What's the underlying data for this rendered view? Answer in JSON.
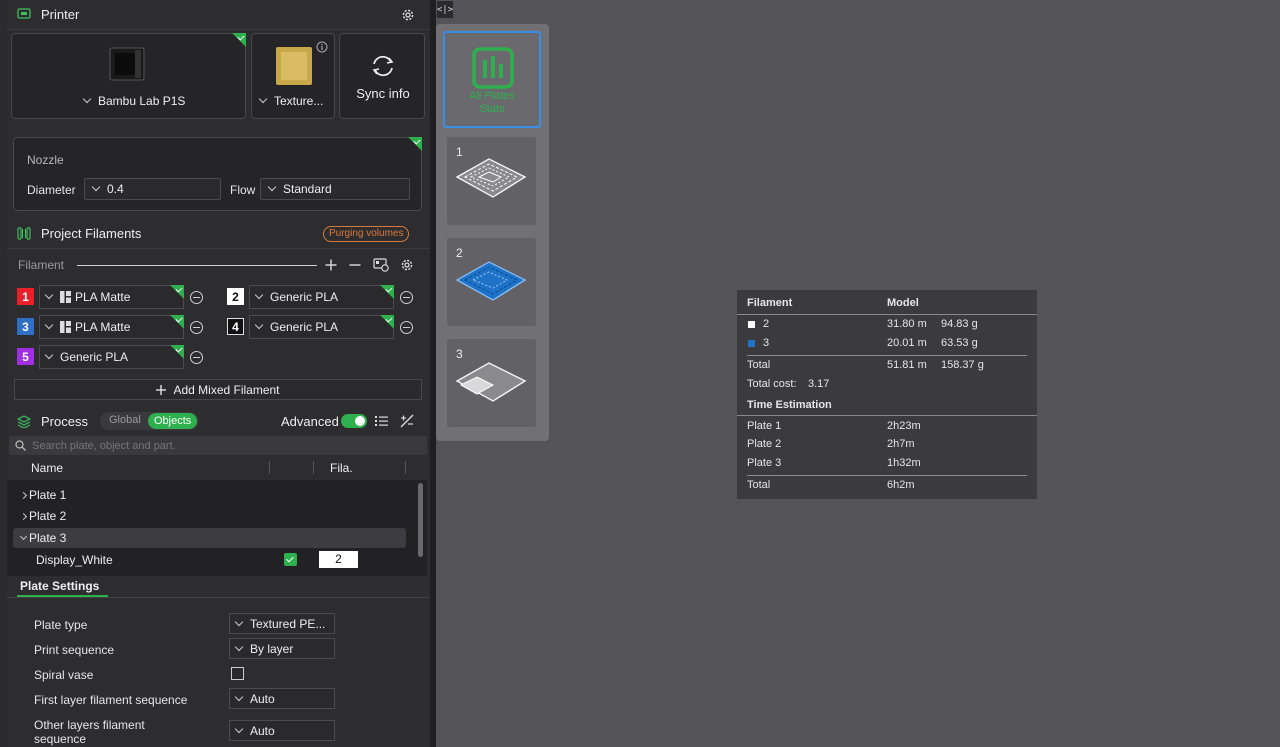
{
  "printer": {
    "title": "Printer",
    "model": "Bambu Lab P1S",
    "plate": "Texture...",
    "sync_label": "Sync info"
  },
  "nozzle": {
    "title": "Nozzle",
    "diameter_label": "Diameter",
    "diameter_value": "0.4",
    "flow_label": "Flow",
    "flow_value": "Standard"
  },
  "filaments": {
    "title": "Project Filaments",
    "purging_label": "Purging volumes",
    "header_label": "Filament",
    "items": [
      {
        "num": "1",
        "name": "PLA Matte",
        "color": "#e8202a"
      },
      {
        "num": "2",
        "name": "Generic PLA",
        "color": "#ffffff"
      },
      {
        "num": "3",
        "name": "PLA Matte",
        "color": "#2f6fc4"
      },
      {
        "num": "4",
        "name": "Generic PLA",
        "color": "#111111"
      },
      {
        "num": "5",
        "name": "Generic PLA",
        "color": "#a12ee0"
      }
    ],
    "add_mixed_label": "Add Mixed Filament"
  },
  "process": {
    "title": "Process",
    "tab_global": "Global",
    "tab_objects": "Objects",
    "advanced_label": "Advanced",
    "search_placeholder": "Search plate, object and part.",
    "col_name": "Name",
    "col_fila": "Fila.",
    "tree": [
      {
        "label": "Plate 1"
      },
      {
        "label": "Plate 2"
      },
      {
        "label": "Plate 3"
      }
    ],
    "object_name": "Display_White",
    "object_fila": "2"
  },
  "plate_settings": {
    "title": "Plate Settings",
    "plate_type_label": "Plate type",
    "plate_type_value": "Textured PE...",
    "print_seq_label": "Print sequence",
    "print_seq_value": "By layer",
    "spiral_label": "Spiral vase",
    "first_layer_label": "First layer filament sequence",
    "first_layer_value": "Auto",
    "other_layers_label": "Other layers filament sequence",
    "other_layers_value": "Auto"
  },
  "plates_bar": {
    "all_stats_label": "All Plates Stats",
    "plates": [
      "1",
      "2",
      "3"
    ]
  },
  "stats": {
    "col_filament": "Filament",
    "col_model": "Model",
    "rows": [
      {
        "id": "2",
        "length": "31.80 m",
        "weight": "94.83 g",
        "color": "#ffffff"
      },
      {
        "id": "3",
        "length": "20.01 m",
        "weight": "63.53 g",
        "color": "#1e73c8"
      }
    ],
    "total_label": "Total",
    "total_length": "51.81 m",
    "total_weight": "158.37 g",
    "total_cost_label": "Total cost:",
    "total_cost_value": "3.17",
    "time_title": "Time Estimation",
    "times": [
      {
        "plate": "Plate 1",
        "time": "2h23m"
      },
      {
        "plate": "Plate 2",
        "time": "2h7m"
      },
      {
        "plate": "Plate 3",
        "time": "1h32m"
      }
    ],
    "time_total_label": "Total",
    "time_total_value": "6h2m"
  },
  "colors": {
    "accent": "#2fb04e",
    "selection": "#3a8ee6",
    "purge": "#d9793a"
  }
}
